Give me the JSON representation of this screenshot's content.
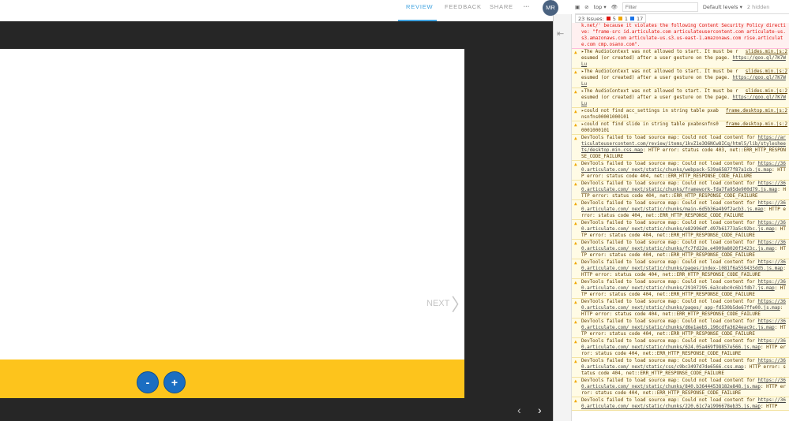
{
  "header": {
    "tabs": [
      "REVIEW",
      "FEEDBACK",
      "SHARE",
      "•••"
    ],
    "avatar": "MR"
  },
  "slide": {
    "next": "NEXT",
    "zoom_out": "-",
    "zoom_in": "+",
    "prev_arrow": "‹",
    "next_arrow": "›"
  },
  "devtools": {
    "context": "top",
    "filter_placeholder": "Filter",
    "levels": "Default levels ▾",
    "hidden": "2 hidden",
    "issues_label": "23 Issues:",
    "issues_errors": "5",
    "issues_warnings": "1",
    "issues_info": "17",
    "messages": [
      {
        "type": "err",
        "text": "k.net/' because it violates the following Content Security Policy directive: \"frame-src id.articulate.com articulateusercontent.com articulate-us.s3.amazonaws.com articulate-us.s3.us-east-1.amazonaws.com rise.articulate.com cmp.osano.com\"."
      },
      {
        "type": "warn",
        "text": "▸The AudioContext was not allowed to start. It must be resumed (or created) after a user gesture on the page.",
        "link": "https://goo.gl/7K7WLu",
        "src": "slides.min.js:2"
      },
      {
        "type": "warn",
        "text": "▸The AudioContext was not allowed to start. It must be resumed (or created) after a user gesture on the page.",
        "link": "https://goo.gl/7K7WLu",
        "src": "slides.min.js:2"
      },
      {
        "type": "warn",
        "text": "▸The AudioContext was not allowed to start. It must be resumed (or created) after a user gesture on the page.",
        "link": "https://goo.gl/7K7WLu",
        "src": "slides.min.js:2"
      },
      {
        "type": "warn",
        "text": "▸could not find acc_settings in string table pxabnsnfns00001000101",
        "src": "frame.desktop.min.js:2"
      },
      {
        "type": "warn",
        "text": "▸could not find slide in string table pxabnsnfns00001000101",
        "src": "frame.desktop.min.js:2"
      },
      {
        "type": "warn",
        "text": "DevTools failed to load source map: Could not load content for",
        "link": "https://articulateusercontent.com/review/items/1kvZ1e3O6NCw8ICq/html5/lib/stylesheets/desktop.min.css.map",
        "tail": ": HTTP error: status code 403, net::ERR_HTTP_RESPONSE_CODE_FAILURE"
      },
      {
        "type": "warn",
        "text": "DevTools failed to load source map: Could not load content for",
        "link": "https://360.articulate.com/_next/static/chunks/webpack-539a65877f87a1cb.js.map",
        "tail": ": HTTP error: status code 404, net::ERR_HTTP_RESPONSE_CODE_FAILURE"
      },
      {
        "type": "warn",
        "text": "DevTools failed to load source map: Could not load content for",
        "link": "https://360.articulate.com/_next/static/chunks/framework-fda7fa95de900d79.js.map",
        "tail": ": HTTP error: status code 404, net::ERR_HTTP_RESPONSE_CODE_FAILURE"
      },
      {
        "type": "warn",
        "text": "DevTools failed to load source map: Could not load content for",
        "link": "https://360.articulate.com/_next/static/chunks/main-6d5b36a4b9f2acb3.js.map",
        "tail": ": HTTP error: status code 404, net::ERR_HTTP_RESPONSE_CODE_FAILURE"
      },
      {
        "type": "warn",
        "text": "DevTools failed to load source map: Could not load content for",
        "link": "https://360.articulate.com/_next/static/chunks/e82996df.d97b61773a5c92bc.js.map",
        "tail": ": HTTP error: status code 404, net::ERR_HTTP_RESPONSE_CODE_FAILURE"
      },
      {
        "type": "warn",
        "text": "DevTools failed to load source map: Could not load content for",
        "link": "https://360.articulate.com/_next/static/chunks/fc7fd22e.e4909a8020f3423c.js.map",
        "tail": ": HTTP error: status code 404, net::ERR_HTTP_RESPONSE_CODE_FAILURE"
      },
      {
        "type": "warn",
        "text": "DevTools failed to load source map: Could not load content for",
        "link": "https://360.articulate.com/_next/static/chunks/pages/index-1081f6a559435dd5.js.map",
        "tail": ": HTTP error: status code 404, net::ERR_HTTP_RESPONSE_CODE_FAILURE"
      },
      {
        "type": "warn",
        "text": "DevTools failed to load source map: Could not load content for",
        "link": "https://360.articulate.com/_next/static/chunks/29107295.6a3cebc0c6b1fdb7.js.map",
        "tail": ": HTTP error: status code 404, net::ERR_HTTP_RESPONSE_CODE_FAILURE"
      },
      {
        "type": "warn",
        "text": "DevTools failed to load source map: Could not load content for",
        "link": "https://360.articulate.com/_next/static/chunks/pages/_app-fd530b5de67ffe00.js.map",
        "tail": ": HTTP error: status code 404, net::ERR_HTTP_RESPONSE_CODE_FAILURE"
      },
      {
        "type": "warn",
        "text": "DevTools failed to load source map: Could not load content for",
        "link": "https://360.articulate.com/_next/static/chunks/d6e1aeb5.196cdfa3624eac9c.js.map",
        "tail": ": HTTP error: status code 404, net::ERR_HTTP_RESPONSE_CODE_FAILURE"
      },
      {
        "type": "warn",
        "text": "DevTools failed to load source map: Could not load content for",
        "link": "https://360.articulate.com/_next/static/chunks/624.05a469f98857e566.js.map",
        "tail": ": HTTP error: status code 404, net::ERR_HTTP_RESPONSE_CODE_FAILURE"
      },
      {
        "type": "warn",
        "text": "DevTools failed to load source map: Could not load content for",
        "link": "https://360.articulate.com/_next/static/css/c9bc3497d7de6566.css.map",
        "tail": ": HTTP error: status code 404, net::ERR_HTTP_RESPONSE_CODE_FAILURE"
      },
      {
        "type": "warn",
        "text": "DevTools failed to load source map: Could not load content for",
        "link": "https://360.articulate.com/_next/static/chunks/840.b36444538182e848.js.map",
        "tail": ": HTTP error: status code 404, net::ERR_HTTP_RESPONSE_CODE_FAILURE"
      },
      {
        "type": "warn",
        "text": "DevTools failed to load source map: Could not load content for",
        "link": "https://360.articulate.com/_next/static/chunks/220.61c7a1996678eb35.js.map",
        "tail": ": HTTP"
      }
    ]
  }
}
